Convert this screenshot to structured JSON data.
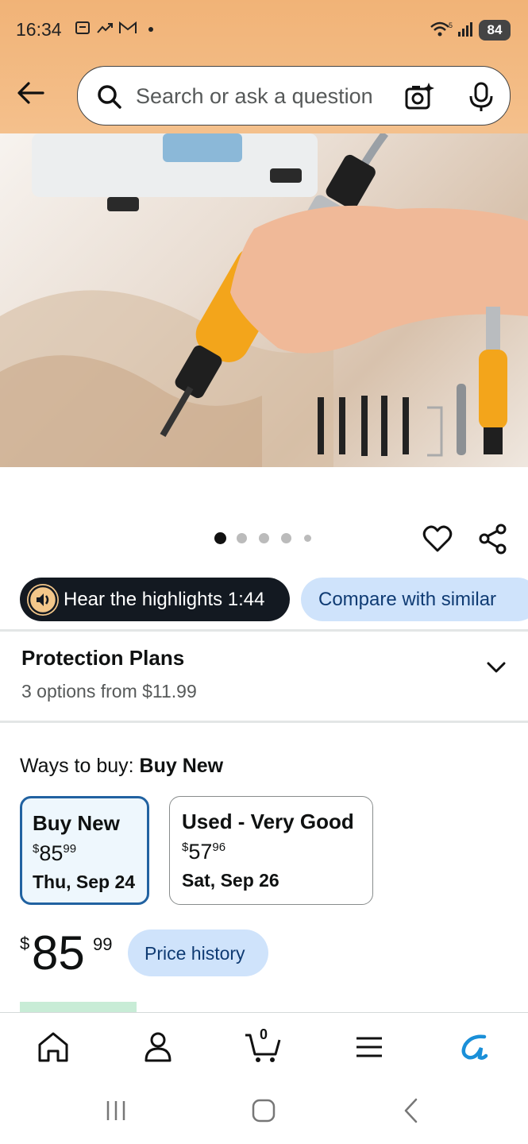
{
  "status_bar": {
    "time": "16:34",
    "battery": "84"
  },
  "search": {
    "placeholder": "Search or ask a question"
  },
  "carousel": {
    "total": 5,
    "active": 0
  },
  "highlights": {
    "label": "Hear the highlights 1:44"
  },
  "compare": {
    "label": "Compare with similar"
  },
  "protection": {
    "title": "Protection Plans",
    "subtitle": "3 options from $11.99"
  },
  "ways_to_buy": {
    "label": "Ways to buy: ",
    "selected": "Buy New"
  },
  "options": [
    {
      "title": "Buy New",
      "currency": "$",
      "whole": "85",
      "cents": "99",
      "date": "Thu, Sep 24"
    },
    {
      "title": "Used - Very Good",
      "currency": "$",
      "whole": "57",
      "cents": "96",
      "date": "Sat, Sep 26"
    }
  ],
  "price": {
    "currency": "$",
    "whole": "85",
    "cents": "99"
  },
  "price_history": {
    "label": "Price history"
  },
  "bottom_nav": {
    "cart_count": "0"
  },
  "colors": {
    "header_bg": "#f2b679",
    "selected_border": "#2162a1",
    "pill_blue": "#cfe3fb",
    "dark_pill": "#131921"
  }
}
